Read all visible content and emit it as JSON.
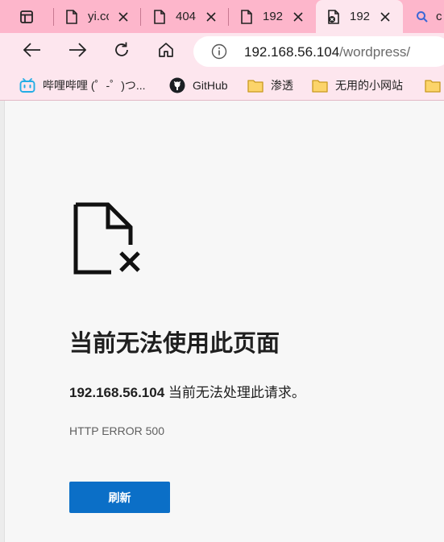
{
  "tabs": [
    {
      "title": "",
      "favicon": "window-icon"
    },
    {
      "title": "yi.cc",
      "favicon": "document-icon"
    },
    {
      "title": "404",
      "favicon": "document-icon"
    },
    {
      "title": "192.",
      "favicon": "document-icon"
    },
    {
      "title": "192.",
      "favicon": "error-document-icon",
      "active": true
    },
    {
      "title": "c",
      "favicon": "search-icon"
    }
  ],
  "toolbar": {
    "url_host": "192.168.56.104",
    "url_path": "/wordpress/"
  },
  "bookmarks": [
    {
      "label": "哔哩哔哩 (゜-゜)つ...",
      "icon": "bilibili-icon"
    },
    {
      "label": "GitHub",
      "icon": "github-icon"
    },
    {
      "label": "渗透",
      "icon": "folder-icon"
    },
    {
      "label": "无用的小网站",
      "icon": "folder-icon"
    }
  ],
  "error": {
    "heading": "当前无法使用此页面",
    "host": "192.168.56.104",
    "message": " 当前无法处理此请求。",
    "code": "HTTP ERROR 500",
    "button_label": "刷新"
  },
  "colors": {
    "tabbar_bg": "#fdb6cb",
    "toolbar_bg": "#fde6ee",
    "button_blue": "#0b6fc7",
    "page_bg": "#f7f7f7"
  }
}
